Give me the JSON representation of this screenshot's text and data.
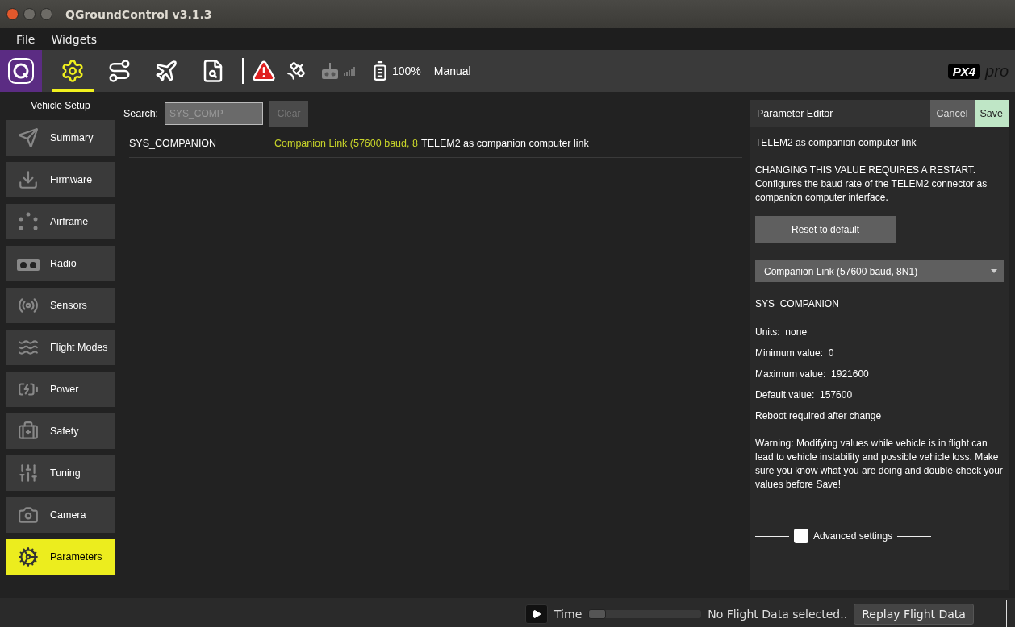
{
  "window": {
    "title": "QGroundControl v3.1.3"
  },
  "menu": [
    {
      "label": "File"
    },
    {
      "label": "Widgets"
    }
  ],
  "toolbar": {
    "tools": [
      {
        "kind": "setup",
        "selected": true
      },
      {
        "kind": "plan",
        "selected": false
      },
      {
        "kind": "fly",
        "selected": false
      },
      {
        "kind": "analyze",
        "selected": false
      }
    ],
    "battery": "100%",
    "mode": "Manual",
    "logo": {
      "mark": "PX4",
      "suffix": "pro"
    }
  },
  "sidebar": {
    "title": "Vehicle Setup",
    "items": [
      {
        "kind": "summary",
        "label": "Summary",
        "selected": false
      },
      {
        "kind": "firmware",
        "label": "Firmware",
        "selected": false
      },
      {
        "kind": "airframe",
        "label": "Airframe",
        "selected": false
      },
      {
        "kind": "radio",
        "label": "Radio",
        "selected": false
      },
      {
        "kind": "sensors",
        "label": "Sensors",
        "selected": false
      },
      {
        "kind": "modes",
        "label": "Flight Modes",
        "selected": false
      },
      {
        "kind": "power",
        "label": "Power",
        "selected": false
      },
      {
        "kind": "safety",
        "label": "Safety",
        "selected": false
      },
      {
        "kind": "tuning",
        "label": "Tuning",
        "selected": false
      },
      {
        "kind": "camera",
        "label": "Camera",
        "selected": false
      },
      {
        "kind": "parameters",
        "label": "Parameters",
        "selected": true
      }
    ]
  },
  "search": {
    "label": "Search:",
    "value": "SYS_COMP",
    "clear": {
      "label": "Clear",
      "disabled": true
    }
  },
  "table": {
    "rows": [
      {
        "name": "SYS_COMPANION",
        "value": "Companion Link (57600 baud, 8",
        "description": "TELEM2 as companion computer link"
      }
    ]
  },
  "editor": {
    "title": "Parameter Editor",
    "cancel": "Cancel",
    "save": "Save",
    "short_description": "TELEM2 as companion computer link",
    "long_description": "CHANGING THIS VALUE REQUIRES A RESTART. Configures the baud rate of the TELEM2 connector as companion computer interface.",
    "reset": "Reset to default",
    "dropdown": "Companion Link (57600 baud, 8N1)",
    "param_name": "SYS_COMPANION",
    "facts": [
      {
        "label": "Units:",
        "value": "none"
      },
      {
        "label": "Minimum value:",
        "value": "0"
      },
      {
        "label": "Maximum value:",
        "value": "1921600"
      },
      {
        "label": "Default value:",
        "value": "157600"
      }
    ],
    "reboot_note": "Reboot required after change",
    "warning": "Warning: Modifying values while vehicle is in flight can lead to vehicle instability and possible vehicle loss. Make sure you know what you are doing and double-check your values before Save!",
    "advanced": {
      "label": "Advanced settings",
      "checked": false
    }
  },
  "replay": {
    "time_label": "Time",
    "level": 0,
    "status": "No Flight Data selected..",
    "button": "Replay Flight Data"
  }
}
